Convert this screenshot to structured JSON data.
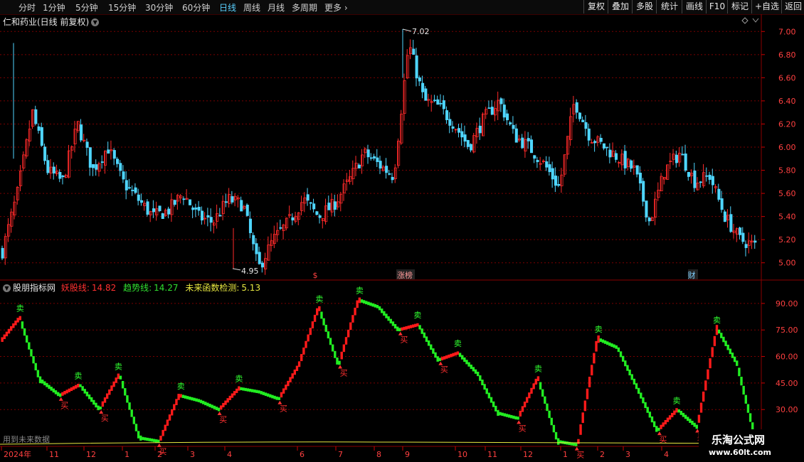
{
  "toolbar": {
    "periods": [
      "分时",
      "1分钟",
      "5分钟",
      "15分钟",
      "30分钟",
      "60分钟",
      "日线",
      "周线",
      "月线",
      "多周期",
      "更多"
    ],
    "active_period": "日线",
    "right_buttons": [
      "复权",
      "叠加",
      "多股",
      "统计",
      "画线",
      "F10",
      "标记",
      "+自选",
      "返回"
    ]
  },
  "main_chart": {
    "title": "仁和药业(日线 前复权)",
    "high_label": "7.02",
    "low_label": "4.95",
    "markers": [
      "$",
      "涨榜",
      "财"
    ],
    "y_ticks": [
      "7.00",
      "6.80",
      "6.60",
      "6.40",
      "6.20",
      "6.00",
      "5.80",
      "5.60",
      "5.40",
      "5.20",
      "5.00"
    ]
  },
  "indicator": {
    "name": "股朋指标网",
    "line1_label": "妖股线:",
    "line1_value": "14.82",
    "line2_label": "趋势线:",
    "line2_value": "14.27",
    "line3_label": "未来函数检测:",
    "line3_value": "5.13",
    "bottom_note": "用到未来数据",
    "y_ticks": [
      "90.00",
      "75.00",
      "60.00",
      "45.00",
      "30.00"
    ],
    "sell_label": "卖",
    "buy_label": "买"
  },
  "time_axis": [
    "2024年",
    "11",
    "12",
    "1",
    "2",
    "3",
    "4",
    "6",
    "7",
    "8",
    "9",
    "10",
    "11",
    "12",
    "1",
    "2",
    "3",
    "4"
  ],
  "watermark": {
    "line1": "乐淘公式网",
    "line2": "www.60lt.com"
  },
  "colors": {
    "up": "#ff2a2a",
    "down": "#4fd6ff",
    "ind_up": "#ff1a1a",
    "ind_down": "#22ee22",
    "grid": "#7a0000",
    "yellow": "#e8e840"
  },
  "chart_data": {
    "type": "candlestick",
    "title": "仁和药业(日线 前复权)",
    "ylim": [
      4.9,
      7.1
    ],
    "price_anchors": [
      5.1,
      5.6,
      6.3,
      5.8,
      5.7,
      6.2,
      5.8,
      6.0,
      5.7,
      5.55,
      5.4,
      5.45,
      5.6,
      5.4,
      5.35,
      5.55,
      5.5,
      4.95,
      5.2,
      5.35,
      5.55,
      5.4,
      5.5,
      5.7,
      5.95,
      5.85,
      5.75,
      6.9,
      6.4,
      6.35,
      6.2,
      6.0,
      6.25,
      6.4,
      6.1,
      6.0,
      5.85,
      5.65,
      6.4,
      6.1,
      6.0,
      5.9,
      5.8,
      5.35,
      5.8,
      5.95,
      5.7,
      5.75,
      5.4,
      5.2,
      5.15
    ],
    "indicator_ylim": [
      10,
      100
    ],
    "indicator_anchors": [
      68,
      82,
      47,
      38,
      44,
      30,
      50,
      14,
      12,
      38,
      35,
      30,
      42,
      40,
      36,
      55,
      88,
      55,
      92,
      88,
      75,
      78,
      58,
      62,
      50,
      28,
      25,
      48,
      12,
      10,
      70,
      65,
      42,
      18,
      30,
      20,
      76,
      56,
      10
    ]
  }
}
